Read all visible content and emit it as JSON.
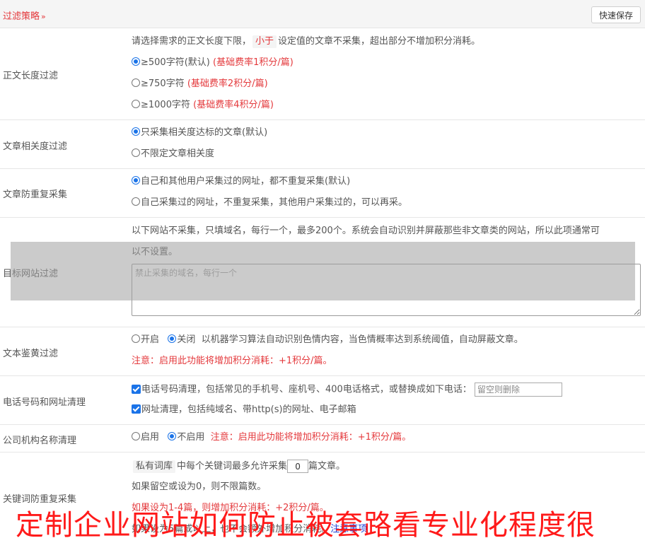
{
  "header": {
    "title": "过滤策略",
    "save_label": "快速保存"
  },
  "length_filter": {
    "label": "正文长度过滤",
    "desc_pre": "请选择需求的正文长度下限，",
    "desc_tag": "小于",
    "desc_post": "设定值的文章不采集，超出部分不增加积分消耗。",
    "options": [
      {
        "label": "≥500字符(默认)",
        "note": "(基础费率1积分/篇)",
        "selected": true
      },
      {
        "label": "≥750字符",
        "note": "(基础费率2积分/篇)",
        "selected": false
      },
      {
        "label": "≥1000字符",
        "note": "(基础费率4积分/篇)",
        "selected": false
      }
    ]
  },
  "relevance_filter": {
    "label": "文章相关度过滤",
    "options": [
      {
        "label": "只采集相关度达标的文章(默认)",
        "selected": true
      },
      {
        "label": "不限定文章相关度",
        "selected": false
      }
    ]
  },
  "dedupe": {
    "label": "文章防重复采集",
    "options": [
      {
        "label": "自己和其他用户采集过的网址，都不重复采集(默认)",
        "selected": true
      },
      {
        "label": "自己采集过的网址，不重复采集，其他用户采集过的，可以再采。",
        "selected": false
      }
    ]
  },
  "site_filter": {
    "label": "目标网站过滤",
    "desc_line1": "以下网站不采集，只填域名，每行一个，最多200个。系统会自动识别并屏蔽那些非文章类的网站，所以此项通常可",
    "desc_line2": "以不设置。",
    "placeholder": "禁止采集的域名，每行一个"
  },
  "porn_filter": {
    "label": "文本鉴黄过滤",
    "on_label": "开启",
    "off_label": "关闭",
    "selected": "off",
    "desc": "以机器学习算法自动识别色情内容，当色情概率达到系统阈值，自动屏蔽文章。",
    "note": "注意：启用此功能将增加积分消耗：+1积分/篇。"
  },
  "phone_url": {
    "label": "电话号码和网址清理",
    "phone_label": "电话号码清理，包括常见的手机号、座机号、400电话格式，或替换成如下电话：",
    "phone_placeholder": "留空则删除",
    "url_label": "网址清理，包括纯域名、带http(s)的网址、电子邮箱",
    "phone_checked": true,
    "url_checked": true
  },
  "org_clean": {
    "label": "公司机构名称清理",
    "on_label": "启用",
    "off_label": "不启用",
    "selected": "off",
    "note": "注意：启用此功能将增加积分消耗：+1积分/篇。"
  },
  "keyword_dedupe": {
    "label": "关键词防重复采集",
    "tag": "私有词库",
    "pre": "中每个关键词最多允许采集",
    "value": "0",
    "post": "篇文章。",
    "line2": "如果留空或设为0，则不限篇数。",
    "note": "如果设为1-4篇，则增加积分消耗：+2积分/篇。",
    "line4_pre": "如果设为5篇或以上，也不会额外增加积分消耗。",
    "line4_link": "注意事项"
  },
  "banner": {
    "text": "定制企业网站如何防止被套路看专业化程度很"
  },
  "colors": {
    "accent_red": "#e4393c",
    "radio_blue": "#1a73e8",
    "banner_red": "#ff1a1a"
  }
}
